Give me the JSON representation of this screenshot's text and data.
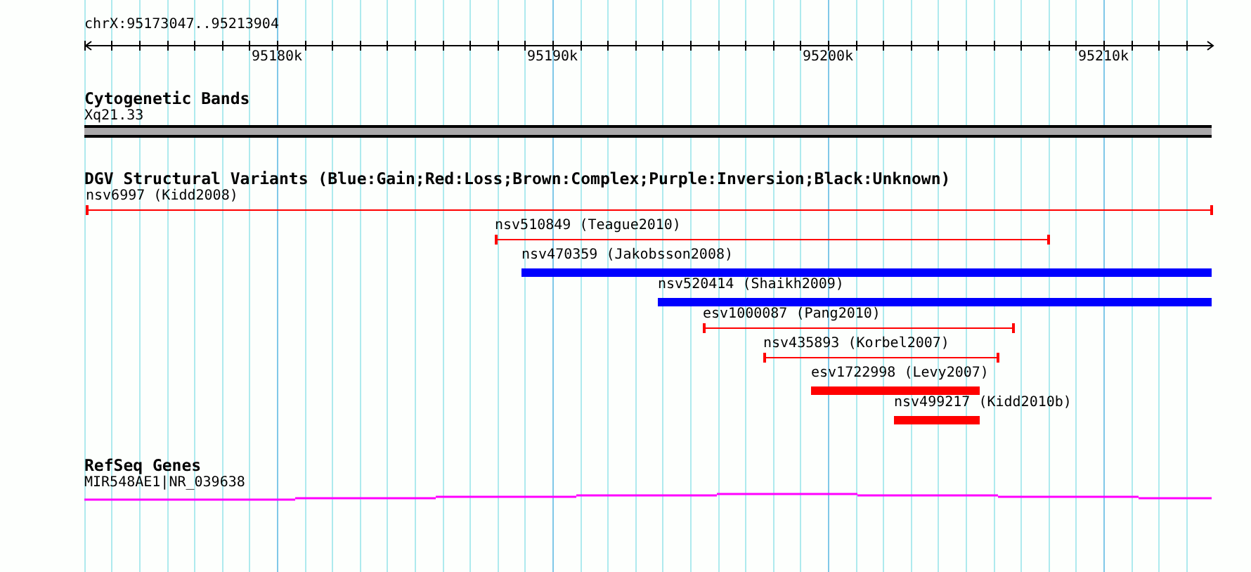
{
  "ruler": {
    "region": "chrX:95173047..95213904",
    "ticks": [
      "95180k",
      "95190k",
      "95200k",
      "95210k"
    ]
  },
  "tracks": [
    {
      "kind": "cytoband",
      "title": "Cytogenetic Bands",
      "features": [
        {
          "label": "Xq21.33"
        }
      ]
    },
    {
      "kind": "variants",
      "title": "DGV Structural Variants (Blue:Gain;Red:Loss;Brown:Complex;Purple:Inversion;Black:Unknown)",
      "features": [
        {
          "label": "nsv6997 (Kidd2008)",
          "kind": "line",
          "color": "#ff0000"
        },
        {
          "label": "nsv510849 (Teague2010)",
          "kind": "line",
          "color": "#ff0000"
        },
        {
          "label": "nsv470359 (Jakobsson2008)",
          "kind": "bar",
          "color": "#0000ff"
        },
        {
          "label": "nsv520414 (Shaikh2009)",
          "kind": "bar",
          "color": "#0000ff"
        },
        {
          "label": "esv1000087 (Pang2010)",
          "kind": "line",
          "color": "#ff0000"
        },
        {
          "label": "nsv435893 (Korbel2007)",
          "kind": "line",
          "color": "#ff0000"
        },
        {
          "label": "esv1722998 (Levy2007)",
          "kind": "bar",
          "color": "#ff0000"
        },
        {
          "label": "nsv499217 (Kidd2010b)",
          "kind": "bar",
          "color": "#ff0000"
        }
      ]
    },
    {
      "kind": "gene",
      "title": "RefSeq Genes",
      "features": [
        {
          "label": "MIR548AE1|NR_039638"
        }
      ]
    }
  ]
}
